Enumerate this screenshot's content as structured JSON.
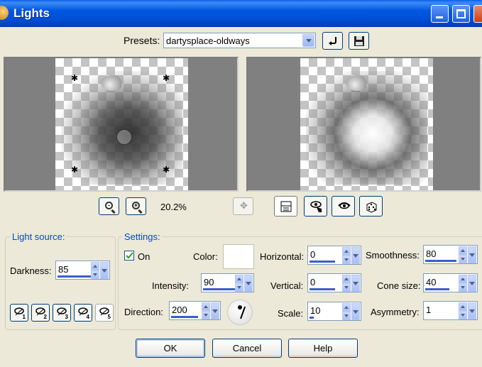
{
  "window": {
    "title": "Lights"
  },
  "presets": {
    "label": "Presets:",
    "value": "dartysplace-oldways"
  },
  "preview": {
    "zoom": "20.2%"
  },
  "light_source": {
    "title": "Light source:",
    "darkness_label": "Darkness:",
    "darkness_value": "85",
    "lights": [
      "1",
      "2",
      "3",
      "4",
      "5"
    ],
    "selected_light": 5
  },
  "settings": {
    "title": "Settings:",
    "on_label": "On",
    "on_checked": true,
    "color_label": "Color:",
    "color_value": "#ffffff",
    "intensity_label": "Intensity:",
    "intensity_value": "90",
    "direction_label": "Direction:",
    "direction_value": "200",
    "horizontal_label": "Horizontal:",
    "horizontal_value": "0",
    "vertical_label": "Vertical:",
    "vertical_value": "0",
    "scale_label": "Scale:",
    "scale_value": "10",
    "smoothness_label": "Smoothness:",
    "smoothness_value": "80",
    "cone_label": "Cone size:",
    "cone_value": "40",
    "asymmetry_label": "Asymmetry:",
    "asymmetry_value": "1"
  },
  "buttons": {
    "ok": "OK",
    "cancel": "Cancel",
    "help": "Help"
  },
  "colors": {
    "titlebar": "#0054e3",
    "group_title": "#0046d5",
    "dialog_bg": "#ece9d8"
  }
}
